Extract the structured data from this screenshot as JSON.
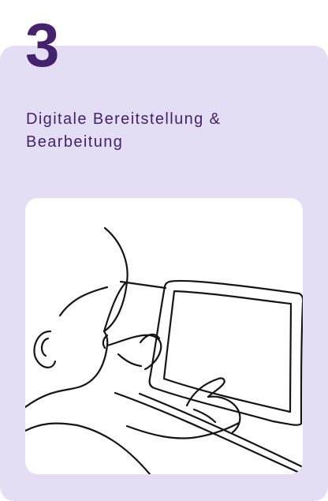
{
  "card": {
    "step_number": "3",
    "title": "Digitale Bereitstellung &\nBearbeitung",
    "illustration_icon": "child-using-tablet-icon"
  },
  "colors": {
    "card_background": "#e4def4",
    "title_color": "#44226e",
    "illustration_background": "#ffffff",
    "stroke": "#151515"
  }
}
